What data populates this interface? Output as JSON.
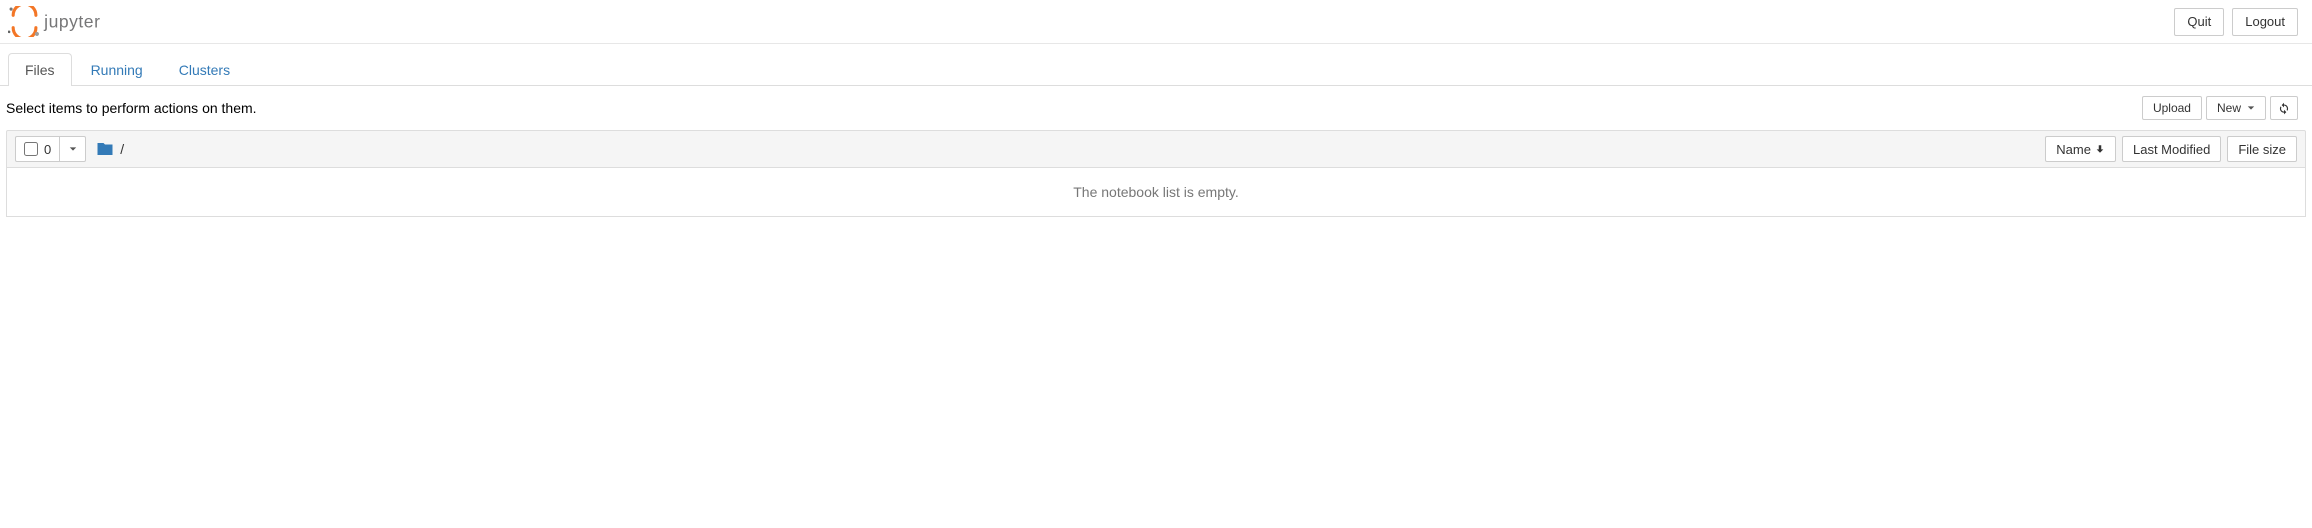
{
  "header": {
    "brand": "jupyter",
    "quit_label": "Quit",
    "logout_label": "Logout"
  },
  "tabs": {
    "files": "Files",
    "running": "Running",
    "clusters": "Clusters",
    "active": "files"
  },
  "toolbar": {
    "hint": "Select items to perform actions on them.",
    "upload_label": "Upload",
    "new_label": "New"
  },
  "list_header": {
    "selected_count": "0",
    "breadcrumb_root": "/",
    "sort_name": "Name",
    "sort_modified": "Last Modified",
    "sort_size": "File size"
  },
  "list_body": {
    "empty_message": "The notebook list is empty."
  },
  "colors": {
    "link": "#337ab7",
    "border": "#ddd",
    "panel_bg": "#f5f5f5"
  }
}
